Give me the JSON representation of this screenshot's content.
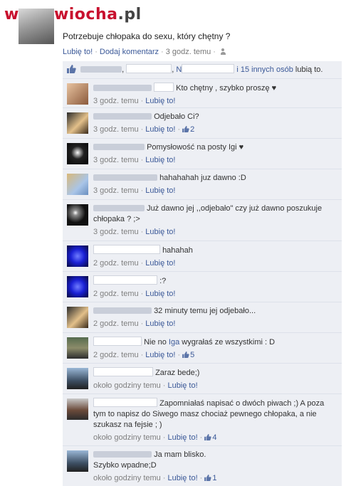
{
  "watermark": {
    "left": "www.",
    "brand": "wiocha",
    "tld": ".pl"
  },
  "post": {
    "text": "Potrzebuje chłopaka do sexu, który chętny ?",
    "like_link": "Lubię to!",
    "comment_link": "Dodaj komentarz",
    "time": "3 godz. temu",
    "dot": "·"
  },
  "likes": {
    "comma1": ",",
    "name_n": "N",
    "others_text": "i 15 innych osób",
    "tail": "lubią to."
  },
  "comments": [
    {
      "text": "Kto chętny , szybko proszę ♥",
      "time": "3 godz. temu",
      "like": "Lubię to!",
      "count": ""
    },
    {
      "text": "Odjebało Ci?",
      "time": "3 godz. temu",
      "like": "Lubię to!",
      "count": "2"
    },
    {
      "text": "Pomysłowość na posty Igi ♥",
      "time": "3 godz. temu",
      "like": "Lubię to!",
      "count": ""
    },
    {
      "text": "hahahahah juz dawno :D",
      "time": "3 godz. temu",
      "like": "Lubię to!",
      "count": ""
    },
    {
      "text": "Już dawno jej ,,odjebało\" czy już dawno poszukuje chłopaka ? ;>",
      "time": "3 godz. temu",
      "like": "Lubię to!",
      "count": ""
    },
    {
      "text": "hahahah",
      "time": "2 godz. temu",
      "like": "Lubię to!",
      "count": ""
    },
    {
      "text": ":?",
      "time": "2 godz. temu",
      "like": "Lubię to!",
      "count": ""
    },
    {
      "text": "32 minuty temu jej odjebało...",
      "time": "2 godz. temu",
      "like": "Lubię to!",
      "count": ""
    },
    {
      "text_pre": "Nie no ",
      "text_link": "Iga",
      "text_post": " wygrałaś ze wszystkimi : D",
      "time": "2 godz. temu",
      "like": "Lubię to!",
      "count": "5"
    },
    {
      "text": "Zaraz bede;)",
      "time": "około godziny temu",
      "like": "Lubię to!",
      "count": ""
    },
    {
      "text": "Zapomniałaś napisać o dwóch piwach ;) A poza tym to napisz do Siwego masz chociaż pewnego chłopaka, a nie szukasz na fejsie ; )",
      "time": "około godziny temu",
      "like": "Lubię to!",
      "count": "4"
    },
    {
      "text": "Ja mam blisko.",
      "text2": "Szybko wpadne;D",
      "time": "około godziny temu",
      "like": "Lubię to!",
      "count": "1"
    }
  ],
  "colors": {
    "link": "#3b5998",
    "thread_bg": "#edeff4",
    "watermark": "#c8102e"
  }
}
